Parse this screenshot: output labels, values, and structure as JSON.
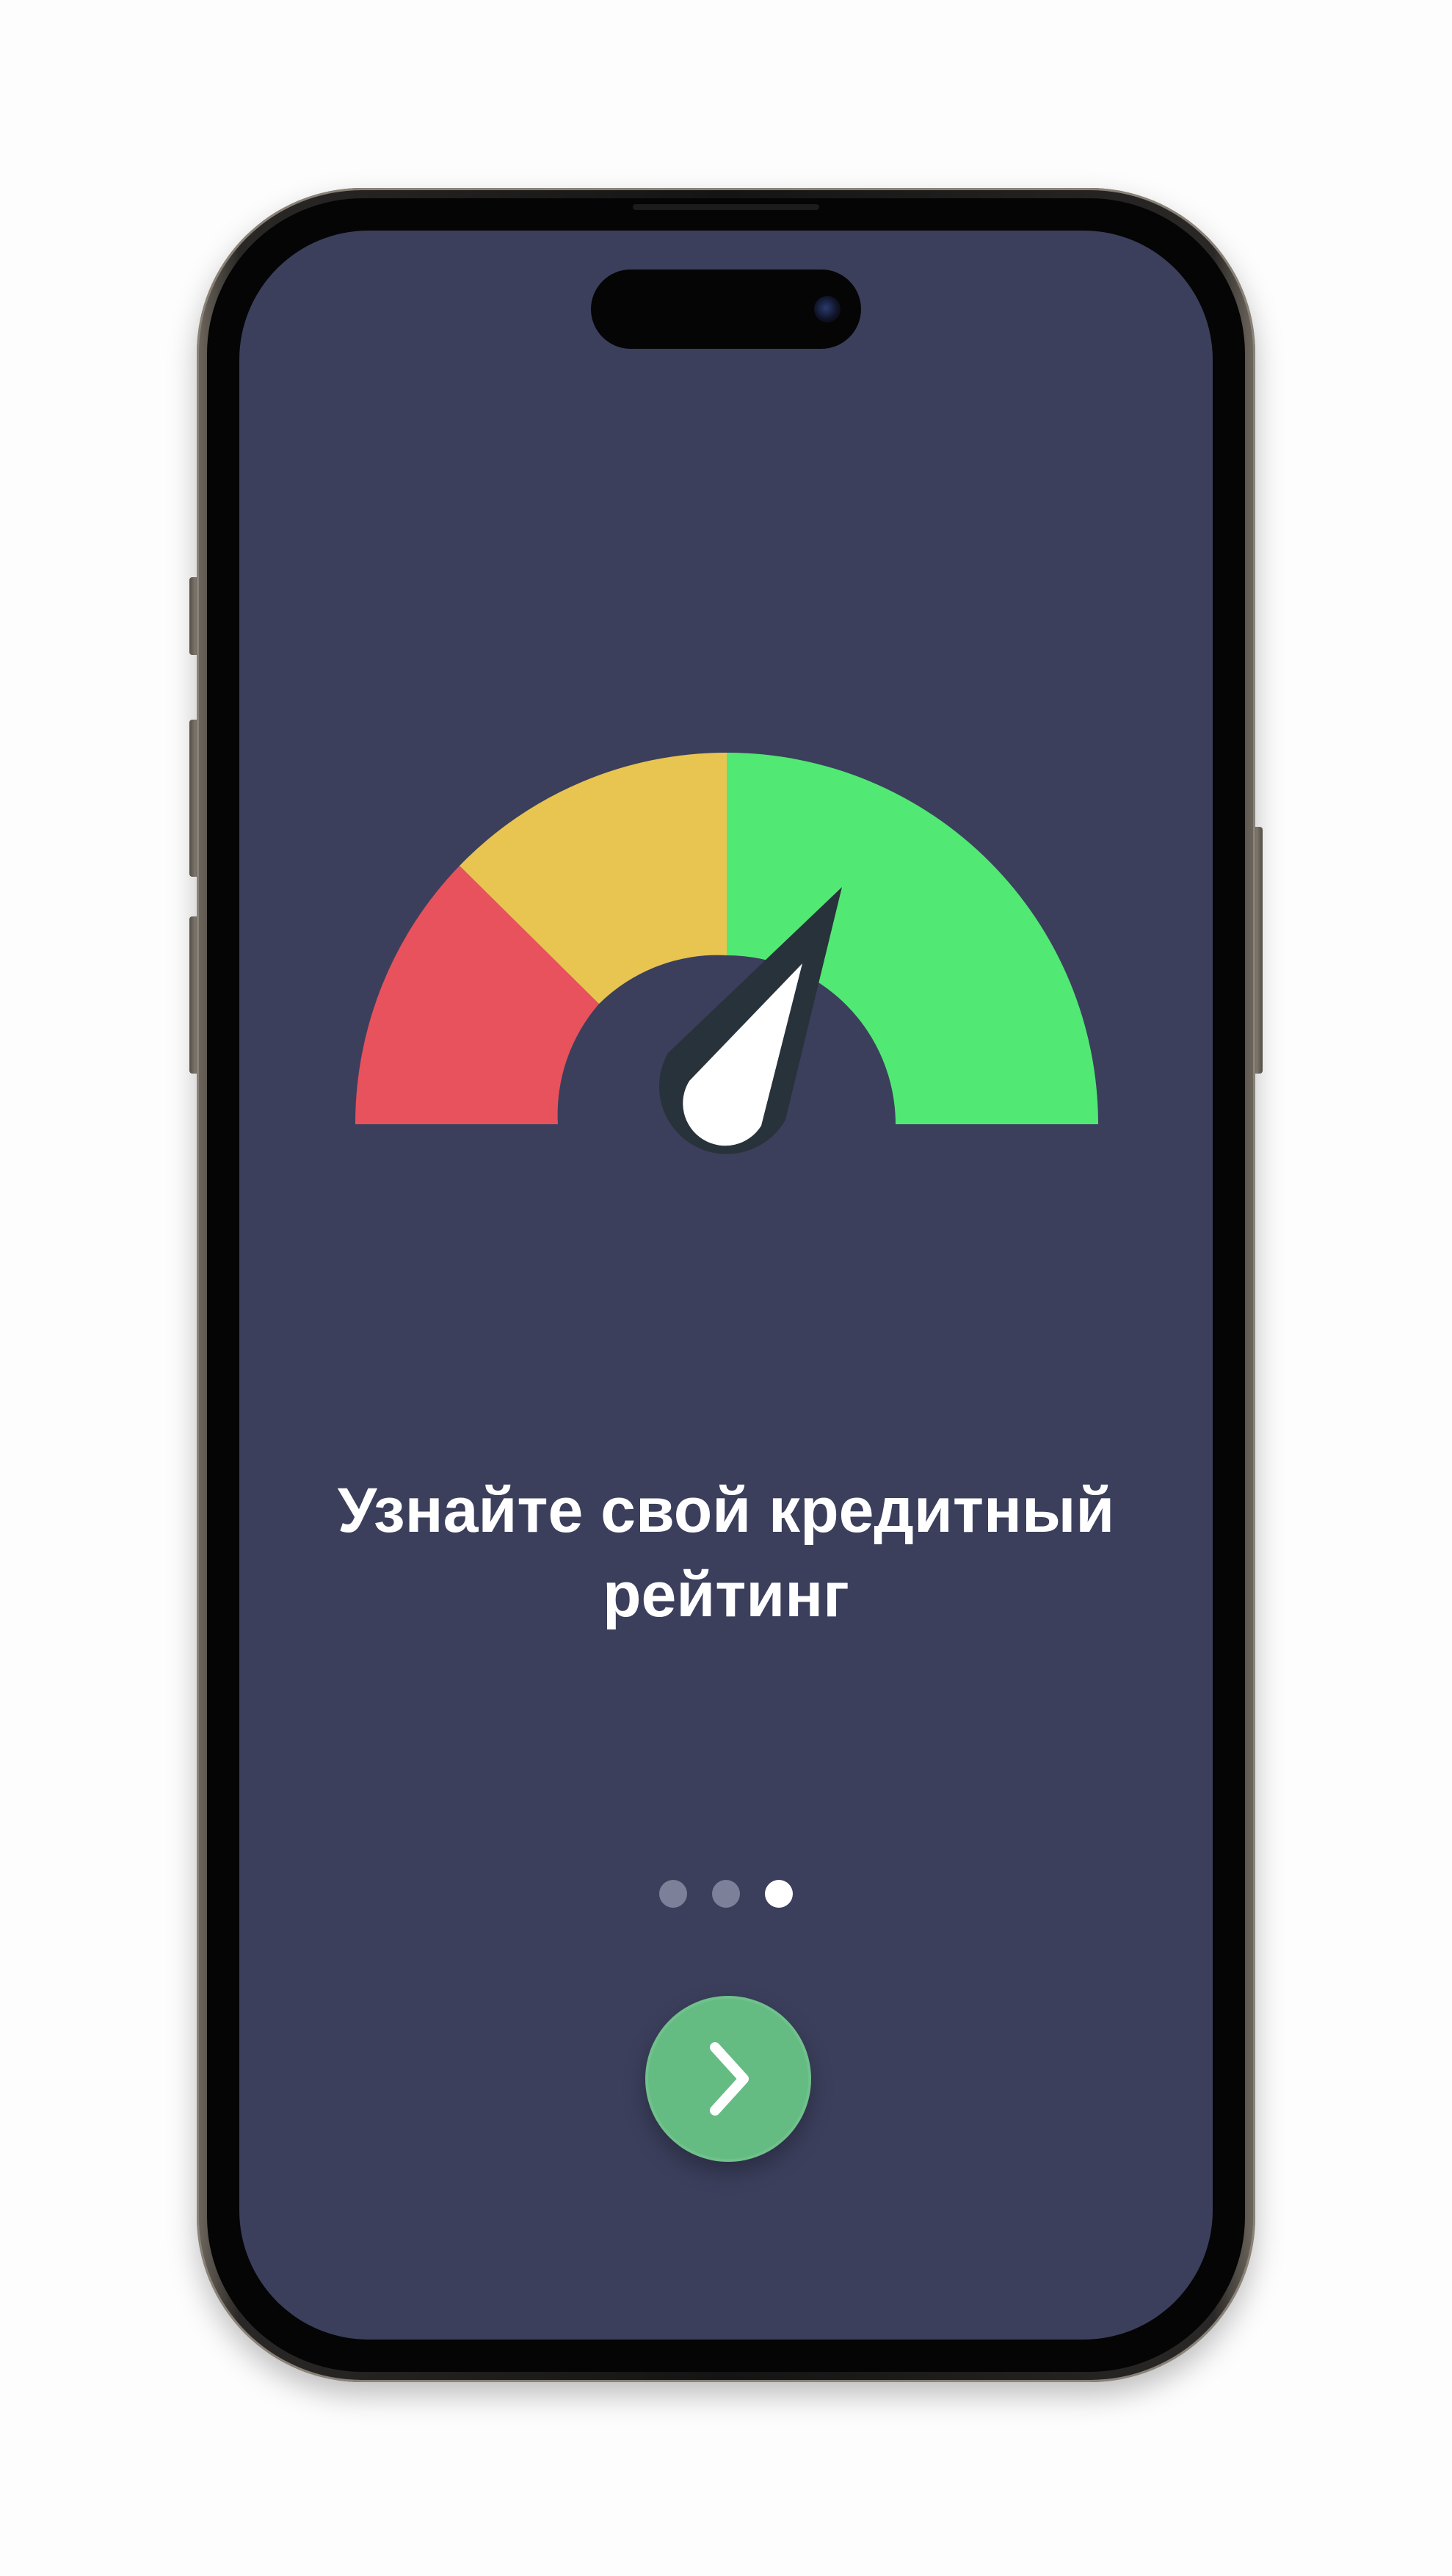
{
  "onboarding": {
    "title_line1": "Узнайте свой кредитный",
    "title_line2": "рейтинг",
    "page_indicator": {
      "total": 3,
      "active_index": 3
    },
    "next_button_icon": "chevron-right-icon"
  },
  "gauge": {
    "icon": "speedometer-icon",
    "segments": [
      {
        "name": "low",
        "color": "#e8525c"
      },
      {
        "name": "medium",
        "color": "#e8c550"
      },
      {
        "name": "high",
        "color": "#52e874"
      }
    ],
    "needle_color": "#ffffff",
    "needle_outline_color": "#28323b"
  },
  "colors": {
    "screen_background": "#3b3f5c",
    "accent_button": "#64bc83",
    "text": "#ffffff",
    "dot_inactive": "#7c8099",
    "dot_active": "#ffffff"
  }
}
